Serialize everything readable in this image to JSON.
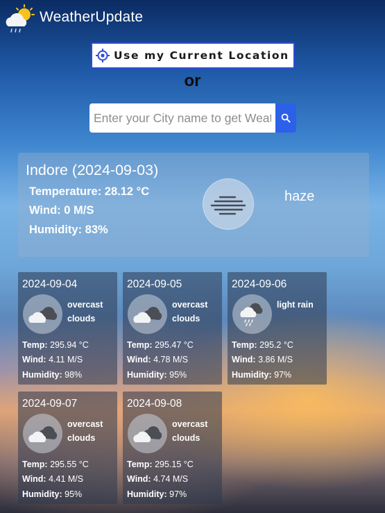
{
  "app": {
    "title": "WeatherUpdate",
    "logo_icon": "cloud-sun-rain-icon"
  },
  "location_button": {
    "label": "Use my Current Location",
    "icon": "crosshair-icon"
  },
  "or_text": "or",
  "search": {
    "placeholder": "Enter your City name to get Weather",
    "value": "",
    "icon": "search-icon",
    "button_color": "#2d60e9"
  },
  "current": {
    "title": "Indore (2024-09-03)",
    "temperature": "Temperature: 28.12 °C",
    "wind": "Wind: 0 M/S",
    "humidity": "Humidity: 83%",
    "description": "haze",
    "icon": "haze-icon"
  },
  "forecast": [
    {
      "date": "2024-09-04",
      "desc1": "overcast",
      "desc2": "clouds",
      "icon": "overcast-clouds-icon",
      "temp_label": "Temp:",
      "temp": "295.94 °C",
      "wind_label": "Wind:",
      "wind": "4.11 M/S",
      "humidity_label": "Humidity:",
      "humidity": "98%"
    },
    {
      "date": "2024-09-05",
      "desc1": "overcast",
      "desc2": "clouds",
      "icon": "overcast-clouds-icon",
      "temp_label": "Temp:",
      "temp": "295.47 °C",
      "wind_label": "Wind:",
      "wind": "4.78 M/S",
      "humidity_label": "Humidity:",
      "humidity": "95%"
    },
    {
      "date": "2024-09-06",
      "desc1": "light rain",
      "desc2": "",
      "icon": "light-rain-icon",
      "temp_label": "Temp:",
      "temp": "295.2 °C",
      "wind_label": "Wind:",
      "wind": "3.86 M/S",
      "humidity_label": "Humidity:",
      "humidity": "97%"
    },
    {
      "date": "2024-09-07",
      "desc1": "overcast",
      "desc2": "clouds",
      "icon": "overcast-clouds-icon",
      "temp_label": "Temp:",
      "temp": "295.55 °C",
      "wind_label": "Wind:",
      "wind": "4.41 M/S",
      "humidity_label": "Humidity:",
      "humidity": "95%"
    },
    {
      "date": "2024-09-08",
      "desc1": "overcast",
      "desc2": "clouds",
      "icon": "overcast-clouds-icon",
      "temp_label": "Temp:",
      "temp": "295.15 °C",
      "wind_label": "Wind:",
      "wind": "4.74 M/S",
      "humidity_label": "Humidity:",
      "humidity": "97%"
    }
  ]
}
